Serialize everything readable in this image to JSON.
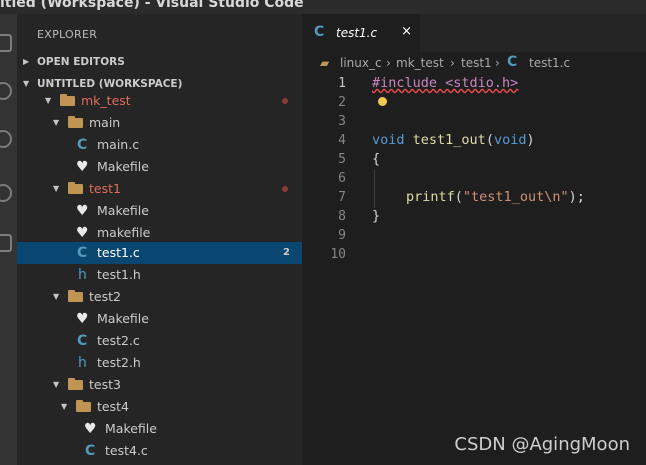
{
  "window": {
    "title": "itled (Workspace) - Visual Studio Code"
  },
  "sidebar": {
    "title": "EXPLORER",
    "sections": {
      "open_editors": "OPEN EDITORS",
      "workspace": "UNTITLED (WORKSPACE)"
    },
    "tree": [
      {
        "label": "mk_test",
        "type": "folder",
        "modified": true
      },
      {
        "label": "main",
        "type": "folder"
      },
      {
        "label": "main.c",
        "type": "c-file"
      },
      {
        "label": "Makefile",
        "type": "makefile"
      },
      {
        "label": "test1",
        "type": "folder",
        "modified": true
      },
      {
        "label": "Makefile",
        "type": "makefile"
      },
      {
        "label": "makefile",
        "type": "makefile"
      },
      {
        "label": "test1.c",
        "type": "c-file",
        "selected": true,
        "badge": "2"
      },
      {
        "label": "test1.h",
        "type": "h-file"
      },
      {
        "label": "test2",
        "type": "folder"
      },
      {
        "label": "Makefile",
        "type": "makefile"
      },
      {
        "label": "test2.c",
        "type": "c-file"
      },
      {
        "label": "test2.h",
        "type": "h-file"
      },
      {
        "label": "test3",
        "type": "folder"
      },
      {
        "label": "test4",
        "type": "folder"
      },
      {
        "label": "Makefile",
        "type": "makefile"
      },
      {
        "label": "test4.c",
        "type": "c-file"
      }
    ]
  },
  "tab": {
    "label": "test1.c",
    "close": "×"
  },
  "breadcrumb": [
    "linux_c",
    "mk_test",
    "test1",
    "test1.c"
  ],
  "editor": {
    "line_numbers": [
      "1",
      "2",
      "3",
      "4",
      "5",
      "6",
      "7",
      "8",
      "9",
      "10"
    ],
    "lines": {
      "l1_directive": "#include <stdio.h>",
      "l4_type": "void",
      "l4_fn": "test1_out",
      "l4_open": "(",
      "l4_param": "void",
      "l4_close": ")",
      "l5": "{",
      "l7_fn": "printf",
      "l7_open": "(",
      "l7_str": "\"test1_out\\n\"",
      "l7_close": ");",
      "l8": "}"
    }
  },
  "watermark": "CSDN @AgingMoon",
  "colors": {
    "selection": "#094771",
    "keyword": "#569cd6",
    "function": "#dcdcaa",
    "string": "#ce9178",
    "modified": "#e06c5a"
  }
}
